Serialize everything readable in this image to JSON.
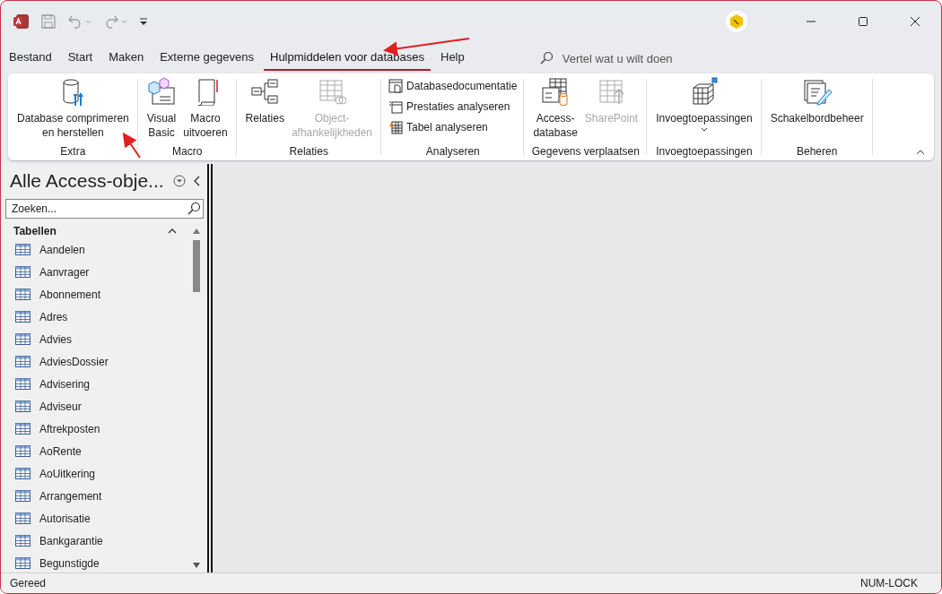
{
  "tabs": [
    {
      "label": "Bestand",
      "selected": false
    },
    {
      "label": "Start",
      "selected": false
    },
    {
      "label": "Maken",
      "selected": false
    },
    {
      "label": "Externe gegevens",
      "selected": false
    },
    {
      "label": "Hulpmiddelen voor databases",
      "selected": true
    },
    {
      "label": "Help",
      "selected": false
    }
  ],
  "tell_me": {
    "placeholder": "Vertel wat u wilt doen"
  },
  "ribbon": {
    "groups": [
      {
        "label": "Extra",
        "buttons": [
          {
            "kind": "large",
            "label": "Database comprimeren\nen herstellen",
            "disabled": false
          }
        ]
      },
      {
        "label": "Macro",
        "buttons": [
          {
            "kind": "large",
            "label": "Visual\nBasic",
            "disabled": false
          },
          {
            "kind": "large",
            "label": "Macro\nuitvoeren",
            "disabled": false
          }
        ]
      },
      {
        "label": "Relaties",
        "buttons": [
          {
            "kind": "large",
            "label": "Relaties",
            "disabled": false
          },
          {
            "kind": "large",
            "label": "Object-\nafhankelijkheden",
            "disabled": true
          }
        ]
      },
      {
        "label": "Analyseren",
        "buttons": [
          {
            "kind": "small",
            "label": "Databasedocumentatie",
            "disabled": false
          },
          {
            "kind": "small",
            "label": "Prestaties analyseren",
            "disabled": false
          },
          {
            "kind": "small",
            "label": "Tabel analyseren",
            "disabled": false
          }
        ]
      },
      {
        "label": "Gegevens verplaatsen",
        "buttons": [
          {
            "kind": "large",
            "label": "Access-\ndatabase",
            "disabled": false
          },
          {
            "kind": "large",
            "label": "SharePoint",
            "disabled": true
          }
        ]
      },
      {
        "label": "Invoegtoepassingen",
        "buttons": [
          {
            "kind": "large",
            "label": "Invoegtoepassingen",
            "disabled": false,
            "dropdown": true
          }
        ]
      },
      {
        "label": "Beheren",
        "buttons": [
          {
            "kind": "large",
            "label": "Schakelbordbeheer",
            "disabled": false
          }
        ]
      }
    ]
  },
  "navigation": {
    "title": "Alle Access-obje...",
    "search": {
      "placeholder": "Zoeken..."
    },
    "section": {
      "label": "Tabellen",
      "expanded": true,
      "items": [
        "Aandelen",
        "Aanvrager",
        "Abonnement",
        "Adres",
        "Advies",
        "AdviesDossier",
        "Advisering",
        "Adviseur",
        "Aftrekposten",
        "AoRente",
        "AoUitkering",
        "Arrangement",
        "Autorisatie",
        "Bankgarantie",
        "Begunstigde"
      ]
    }
  },
  "status_bar": {
    "left": "Gereed",
    "right": "NUM-LOCK"
  }
}
